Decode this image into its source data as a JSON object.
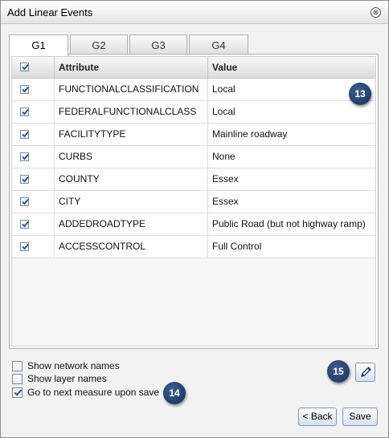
{
  "window": {
    "title": "Add Linear Events",
    "close_glyph": "⊗"
  },
  "tabs": [
    {
      "label": "G1",
      "active": true
    },
    {
      "label": "G2",
      "active": false
    },
    {
      "label": "G3",
      "active": false
    },
    {
      "label": "G4",
      "active": false
    }
  ],
  "grid": {
    "columns": [
      "Attribute",
      "Value"
    ],
    "header_checked": true,
    "rows": [
      {
        "checked": true,
        "attribute": "FUNCTIONALCLASSIFICATION",
        "value": "Local"
      },
      {
        "checked": true,
        "attribute": "FEDERALFUNCTIONALCLASS",
        "value": "Local"
      },
      {
        "checked": true,
        "attribute": "FACILITYTYPE",
        "value": "Mainline roadway"
      },
      {
        "checked": true,
        "attribute": "CURBS",
        "value": "None"
      },
      {
        "checked": true,
        "attribute": "COUNTY",
        "value": "Essex"
      },
      {
        "checked": true,
        "attribute": "CITY",
        "value": "Essex"
      },
      {
        "checked": true,
        "attribute": "ADDEDROADTYPE",
        "value": "Public Road (but not highway ramp)"
      },
      {
        "checked": true,
        "attribute": "ACCESSCONTROL",
        "value": "Full Control"
      }
    ]
  },
  "options": [
    {
      "label": "Show network names",
      "checked": false
    },
    {
      "label": "Show layer names",
      "checked": false
    },
    {
      "label": "Go to next measure upon save",
      "checked": true
    }
  ],
  "callouts": {
    "grid": "13",
    "options": "14",
    "edit": "15"
  },
  "buttons": {
    "back": "< Back",
    "save": "Save"
  },
  "icons": {
    "close": "close-icon",
    "edit": "pencil-icon",
    "check": "checkmark-icon"
  },
  "colors": {
    "callout": "#1f3a66",
    "button_border": "#7f95b7",
    "check": "#2b4f8a"
  }
}
